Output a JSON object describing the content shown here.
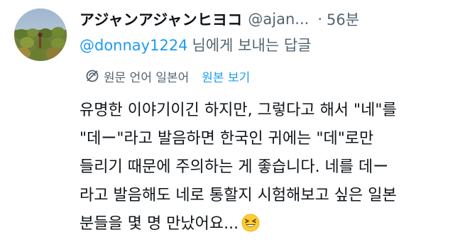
{
  "author": {
    "display_name": "アジャンアジャンヒヨコ",
    "handle": "@ajan...",
    "separator": "·",
    "time": "56분"
  },
  "reply": {
    "to_handle": "@donnay1224",
    "suffix": "님에게 보내는 답글"
  },
  "translation": {
    "icon": "translate-slash-icon",
    "label": "원문 언어 일본어",
    "link": "원본 보기"
  },
  "body": {
    "lines": [
      "유명한 이야기이긴 하지만, 그렇다고 해서 \"네\"를",
      "\"데ー\"라고 발음하면 한국인 귀에는 \"데\"로만",
      "들리기 때문에 주의하는 게 좋습니다. 네를 데ー",
      "라고 발음해도 네로 통할지 시험해보고 싶은 일본",
      "분들을 몇 명 만났어요..."
    ],
    "emoji": "grinning-squinting-face-emoji"
  },
  "colors": {
    "link_blue": "#1d9bf0",
    "secondary_gray": "#536471",
    "text": "#0f1419"
  }
}
